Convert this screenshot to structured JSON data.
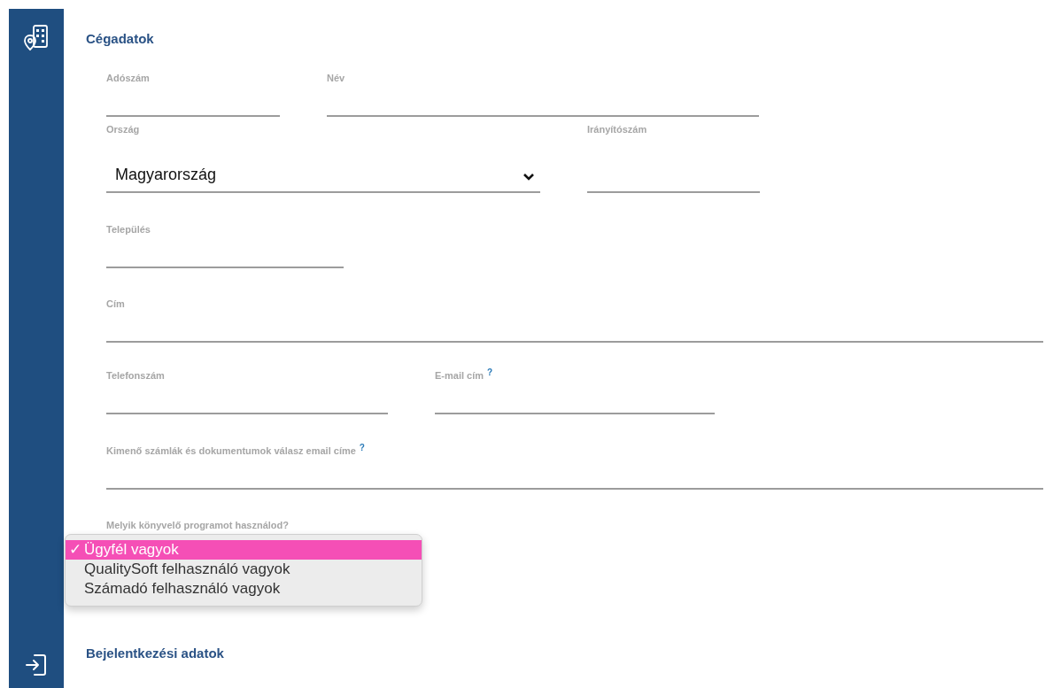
{
  "sections": [
    {
      "title": "Cégadatok",
      "rows": [
        [
          {
            "label": "Adószám",
            "kind": "text"
          },
          {
            "label": "Név",
            "kind": "text"
          }
        ],
        [
          {
            "label": "Ország",
            "kind": "select",
            "value": "Magyarország"
          },
          {
            "label": "Irányítószám",
            "kind": "text"
          }
        ],
        [
          {
            "label": "Település",
            "kind": "text"
          }
        ],
        [
          {
            "label": "Cím",
            "kind": "text"
          }
        ],
        [
          {
            "label": "Telefonszám",
            "kind": "text"
          },
          {
            "label": "E-mail cím",
            "kind": "text",
            "help": "?"
          }
        ],
        [
          {
            "label": "Kimenő számlák és dokumentumok válasz email címe",
            "kind": "text",
            "help": "?"
          }
        ],
        [
          {
            "label": "Melyik könyvelő programot használod?",
            "kind": "menu",
            "check": "✓",
            "options": [
              {
                "label": "Ügyfél vagyok",
                "selected": true
              },
              {
                "label": "QualitySoft felhasználó vagyok",
                "selected": false
              },
              {
                "label": "Számadó felhasználó vagyok",
                "selected": false
              }
            ]
          }
        ]
      ]
    },
    {
      "title": "Bejelentkezési adatok"
    }
  ]
}
